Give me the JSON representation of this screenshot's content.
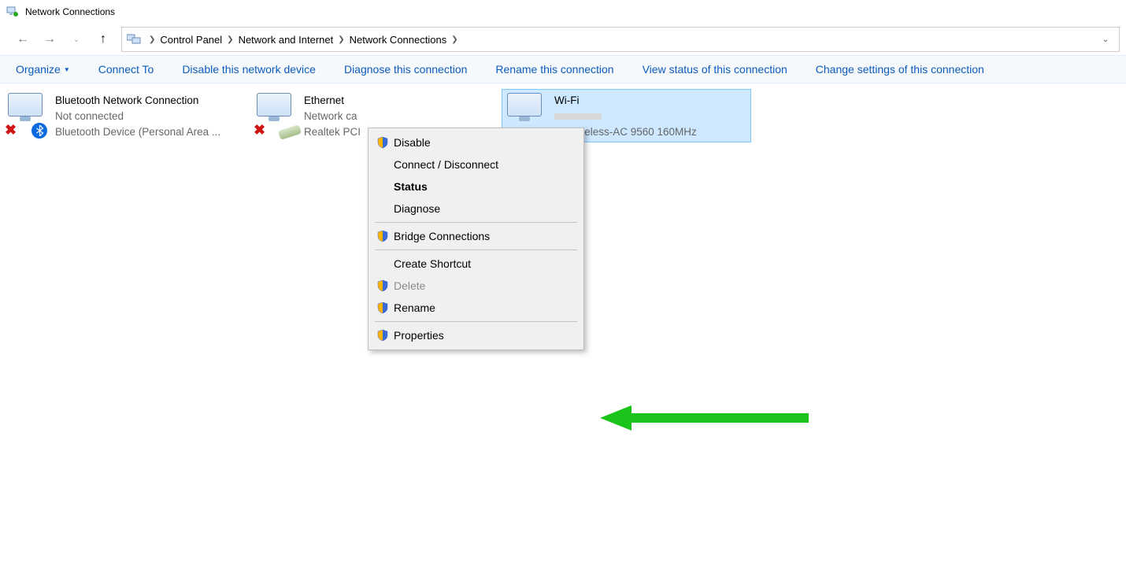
{
  "window": {
    "title": "Network Connections"
  },
  "breadcrumb": {
    "items": [
      "Control Panel",
      "Network and Internet",
      "Network Connections"
    ]
  },
  "toolbar": {
    "organize": "Organize",
    "connect_to": "Connect To",
    "disable": "Disable this network device",
    "diagnose": "Diagnose this connection",
    "rename": "Rename this connection",
    "view_status": "View status of this connection",
    "change_settings": "Change settings of this connection"
  },
  "connections": {
    "bluetooth": {
      "name": "Bluetooth Network Connection",
      "status": "Not connected",
      "device": "Bluetooth Device (Personal Area ..."
    },
    "ethernet": {
      "name": "Ethernet",
      "status": "Network ca",
      "device": "Realtek PCI"
    },
    "wifi": {
      "name": "Wi-Fi",
      "status": "",
      "device": "R) Wireless-AC 9560 160MHz"
    }
  },
  "context_menu": {
    "disable": "Disable",
    "connect_disconnect": "Connect / Disconnect",
    "status": "Status",
    "diagnose": "Diagnose",
    "bridge": "Bridge Connections",
    "create_shortcut": "Create Shortcut",
    "delete": "Delete",
    "rename": "Rename",
    "properties": "Properties"
  }
}
